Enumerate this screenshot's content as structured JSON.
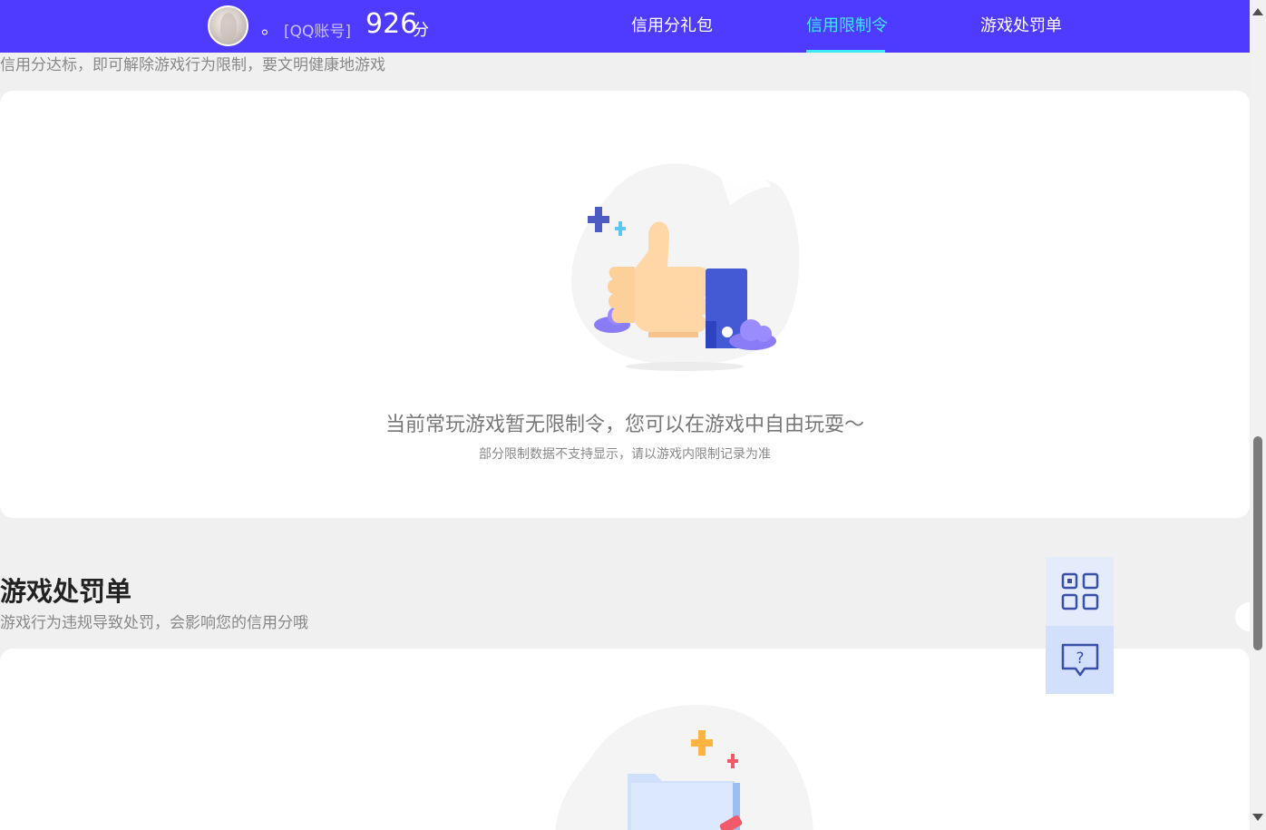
{
  "header": {
    "nickname": "。",
    "account_type": "[QQ账号]",
    "score": "926",
    "score_unit": "分",
    "nav": [
      {
        "label": "信用分礼包",
        "active": false
      },
      {
        "label": "信用限制令",
        "active": true
      },
      {
        "label": "游戏处罚单",
        "active": false
      }
    ]
  },
  "restriction_section": {
    "description": "信用分达标，即可解除游戏行为限制，要文明健康地游戏",
    "empty_title": "当前常玩游戏暂无限制令，您可以在游戏中自由玩耍～",
    "empty_subtitle": "部分限制数据不支持显示，请以游戏内限制记录为准"
  },
  "penalty_section": {
    "title": "游戏处罚单",
    "description": "游戏行为违规导致处罚，会影响您的信用分哦"
  },
  "floating_tools": {
    "qr_icon": "qr-code-icon",
    "help_icon": "help-chat-icon"
  },
  "colors": {
    "header_bg": "#4f3bff",
    "nav_active": "#3ee8ff",
    "page_bg": "#f0f0f0",
    "card_bg": "#ffffff"
  }
}
